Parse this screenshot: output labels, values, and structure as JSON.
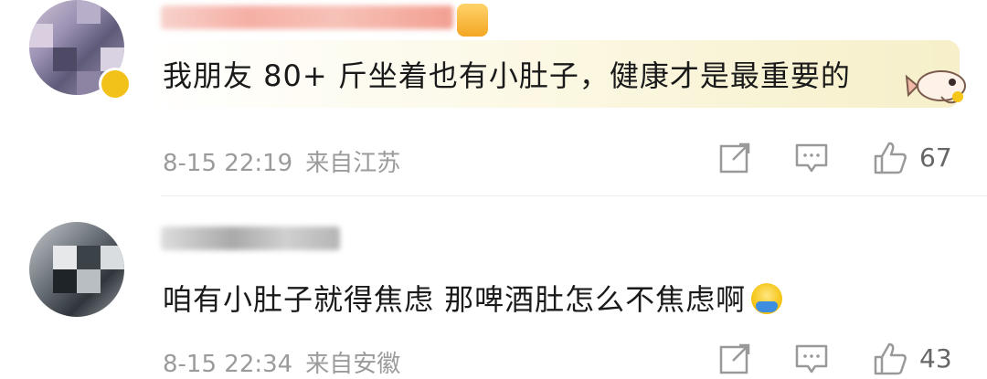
{
  "comments": [
    {
      "text": "我朋友 80+ 斤坐着也有小肚子，健康才是最重要的",
      "date": "8-15 22:19",
      "location": "来自江苏",
      "likes": "67",
      "icons": {
        "share": "share-icon",
        "reply": "comment-icon",
        "like": "thumbs-up-icon"
      }
    },
    {
      "text": "咱有小肚子就得焦虑 那啤酒肚怎么不焦虑啊",
      "date": "8-15 22:34",
      "location": "来自安徽",
      "likes": "43",
      "icons": {
        "share": "share-icon",
        "reply": "comment-icon",
        "like": "thumbs-up-icon"
      }
    }
  ],
  "colors": {
    "meta_text": "#9b9b9b",
    "body_text": "#1a1a1a",
    "divider": "#ececec"
  }
}
